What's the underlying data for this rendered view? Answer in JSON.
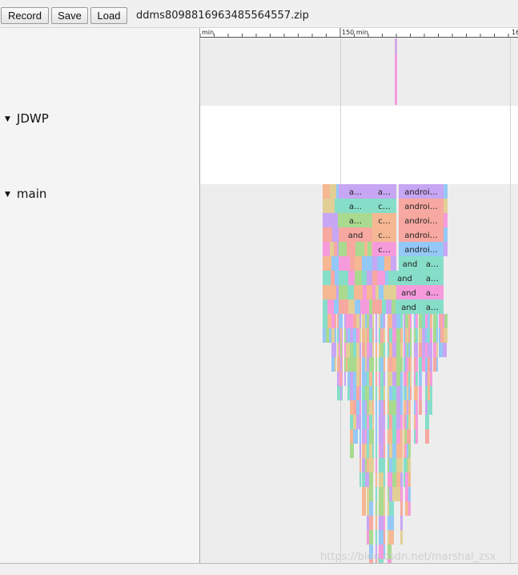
{
  "toolbar": {
    "record_label": "Record",
    "save_label": "Save",
    "load_label": "Load",
    "file_name": "ddms8098816963485564557.zip"
  },
  "threads": [
    {
      "name": "JDWP"
    },
    {
      "name": "main"
    }
  ],
  "ruler": {
    "labels": [
      "min",
      "150 min",
      "16"
    ]
  },
  "flame_labels": [
    "a…",
    "a…",
    "androi…",
    "a…",
    "c…",
    "androi…",
    "a…",
    "c…",
    "androi…",
    "and",
    "c…",
    "androi…",
    "c…",
    "androi…",
    "and",
    "a…",
    "and",
    "a…",
    "and",
    "a…",
    "and",
    "a…"
  ],
  "watermark": "https://blog.csdn.net/marshal_zsx",
  "colors": {
    "purple": "#c7a6f3",
    "teal": "#86dec9",
    "orange": "#f5b893",
    "pink": "#f59bdc",
    "blue": "#94c8f6",
    "green": "#a9da8f",
    "salmon": "#f7a8a0",
    "tan": "#e2cf96"
  }
}
